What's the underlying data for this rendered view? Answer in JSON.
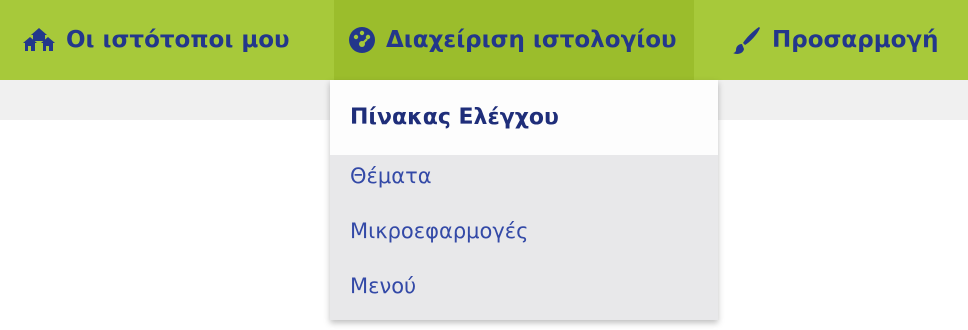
{
  "adminbar": {
    "background_color": "#a7c93a",
    "items": [
      {
        "label": "Οι ιστότοποι μου",
        "icon": "sites-icon"
      },
      {
        "label": "Διαχείριση ιστολογίου",
        "icon": "dashboard-icon"
      },
      {
        "label": "Προσαρμογή",
        "icon": "paintbrush-icon"
      }
    ]
  },
  "dropdown": {
    "items": [
      {
        "label": "Πίνακας Ελέγχου",
        "current": true
      },
      {
        "label": "Θέματα"
      },
      {
        "label": "Μικροεφαρμογές"
      },
      {
        "label": "Μενού"
      }
    ]
  }
}
